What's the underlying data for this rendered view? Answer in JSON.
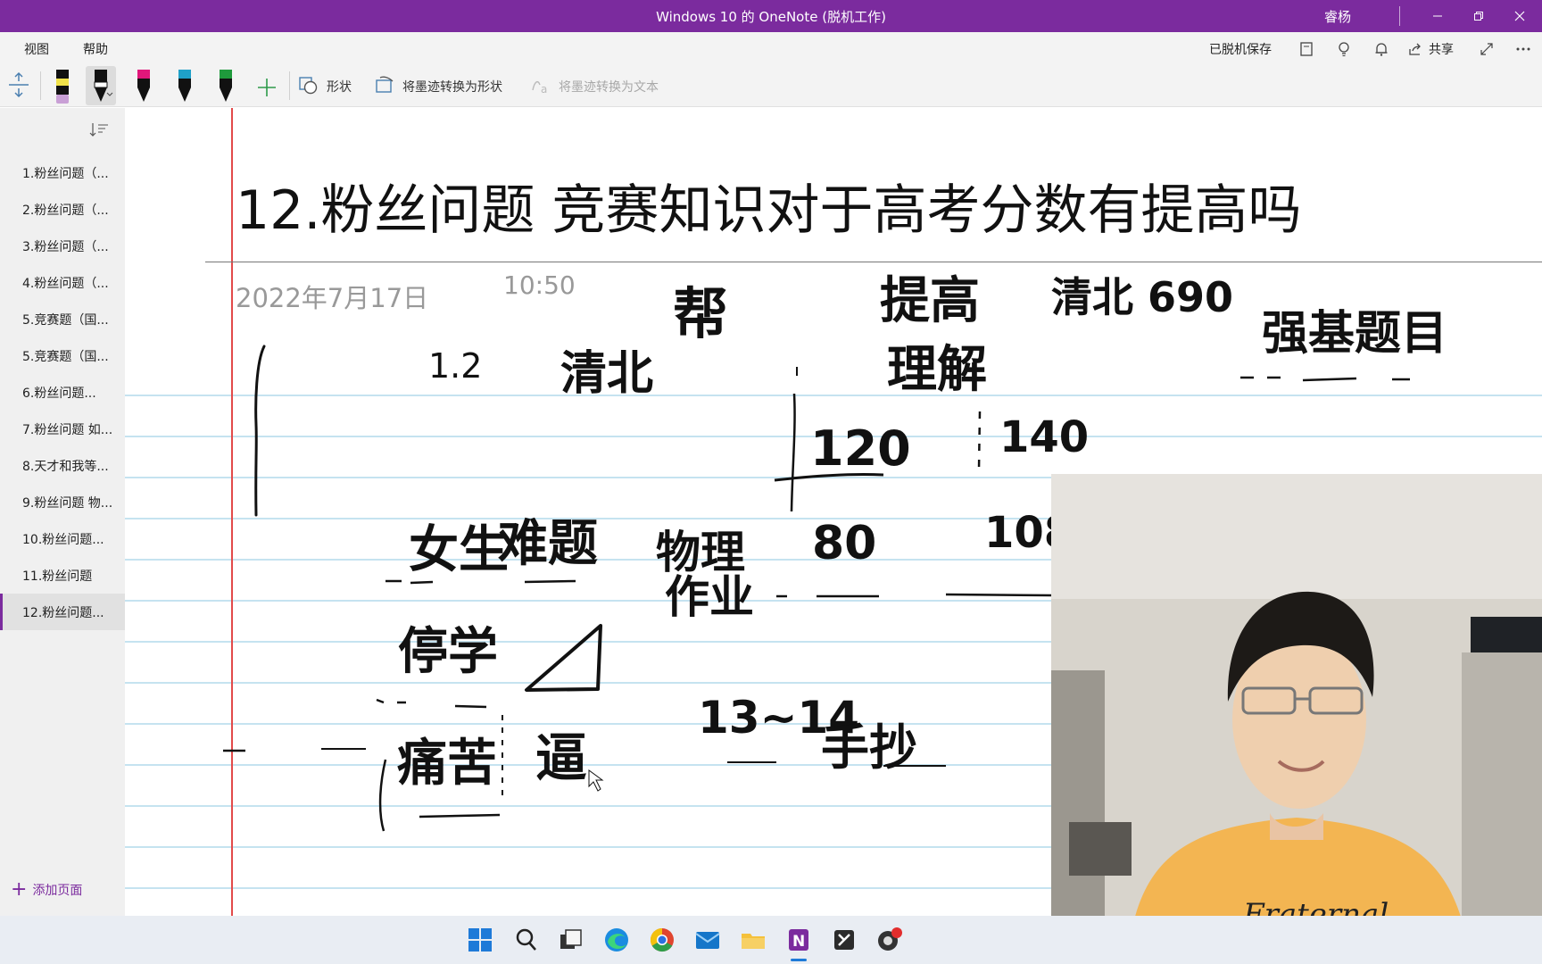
{
  "window": {
    "title": "Windows 10 的 OneNote (脱机工作)",
    "user": "睿杨"
  },
  "menu": {
    "view": "视图",
    "help": "帮助",
    "saved_status": "已脱机保存",
    "share": "共享"
  },
  "toolbar": {
    "shapes_label": "形状",
    "ink_to_shape_label": "将墨迹转换为形状",
    "ink_to_text_label": "将墨迹转换为文本",
    "pen_colors": [
      "#f1e24a",
      "#111111",
      "#e0177a",
      "#1fa0c8",
      "#1f9a3c"
    ],
    "accent": "#7b2b9e"
  },
  "pages": [
    {
      "label": "1.粉丝问题（..."
    },
    {
      "label": "2.粉丝问题（..."
    },
    {
      "label": "3.粉丝问题（..."
    },
    {
      "label": "4.粉丝问题（..."
    },
    {
      "label": "5.竞赛题（国..."
    },
    {
      "label": "5.竞赛题（国..."
    },
    {
      "label": "6.粉丝问题..."
    },
    {
      "label": "7.粉丝问题 如..."
    },
    {
      "label": "8.天才和我等..."
    },
    {
      "label": "9.粉丝问题 物..."
    },
    {
      "label": "10.粉丝问题..."
    },
    {
      "label": "11.粉丝问题"
    },
    {
      "label": "12.粉丝问题..."
    }
  ],
  "add_page": "添加页面",
  "note": {
    "title": "12.粉丝问题 竞赛知识对于高考分数有提高吗",
    "date": "2022年7月17日",
    "time": "10:50",
    "handwriting": {
      "t1": "1.2",
      "t2": "清北",
      "t3": "帮",
      "t4": "提高",
      "t5": "理解",
      "t6": "清北 690",
      "t7": "强基题目",
      "t8": "120",
      "t9": "140",
      "t10": "女生",
      "t11": "难题",
      "t12": "物理",
      "t13": "作业",
      "t14": "80",
      "t15": "108",
      "t16": "停学",
      "t17": "痛苦",
      "t18": "逼",
      "t19": "13~14",
      "t20": "手抄"
    }
  }
}
